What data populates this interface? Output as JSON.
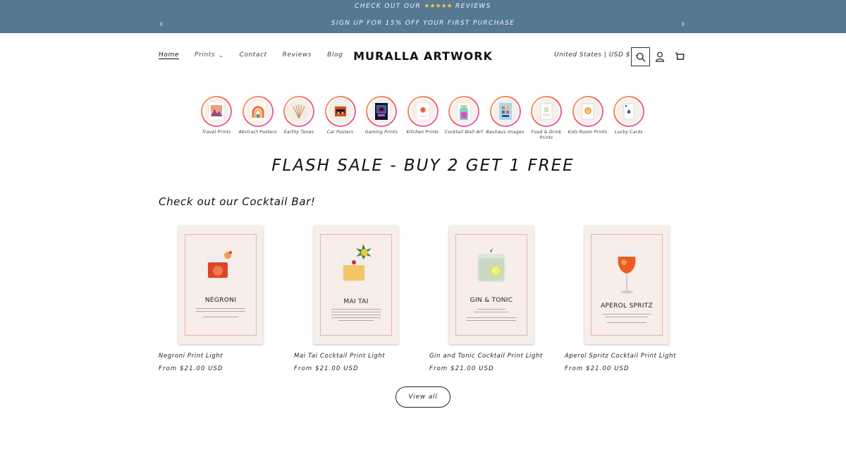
{
  "announcement": {
    "line1_before": "CHECK OUT OUR",
    "stars": "★★★★★",
    "line1_after": "REVIEWS",
    "line2": "SIGN UP FOR 15% OFF YOUR FIRST PURCHASE",
    "prev_icon": "‹",
    "next_icon": "›"
  },
  "header": {
    "nav": [
      {
        "label": "Home"
      },
      {
        "label": "Prints",
        "chevron": "⌄"
      },
      {
        "label": "Contact"
      },
      {
        "label": "Reviews"
      },
      {
        "label": "Blog"
      }
    ],
    "logo": "MURALLA ARTWORK",
    "country": "United States | USD $",
    "country_chevron": "⌄"
  },
  "categories": [
    {
      "label": "Travel Prints"
    },
    {
      "label": "Abstract Posters"
    },
    {
      "label": "Earthy Tones"
    },
    {
      "label": "Car Posters"
    },
    {
      "label": "Gaming Prints"
    },
    {
      "label": "Kitchen Prints"
    },
    {
      "label": "Cocktail Wall Art"
    },
    {
      "label": "Bauhaus Images"
    },
    {
      "label": "Food & Drink Prints"
    },
    {
      "label": "Kids Room Prints"
    },
    {
      "label": "Lucky Cards"
    }
  ],
  "flash_sale": "FLASH SALE - BUY 2 GET 1 FREE",
  "section_title": "Check out our Cocktail Bar!",
  "products": [
    {
      "poster_title": "NEGRONI",
      "name": "Negroni Print Light",
      "price": "From $21.00 USD"
    },
    {
      "poster_title": "MAI TAI",
      "name": "Mai Tai Cocktail Print Light",
      "price": "From $21.00 USD"
    },
    {
      "poster_title": "GIN & TONIC",
      "name": "Gin and Tonic Cocktail Print Light",
      "price": "From $21.00 USD"
    },
    {
      "poster_title": "APEROL SPRITZ",
      "name": "Aperol Spritz Cocktail Print Light",
      "price": "From $21.00 USD"
    }
  ],
  "view_all": "View all",
  "colors": {
    "announcement_bg": "#557990",
    "star": "#f5c84a",
    "poster_bg": "#f7ede9"
  }
}
